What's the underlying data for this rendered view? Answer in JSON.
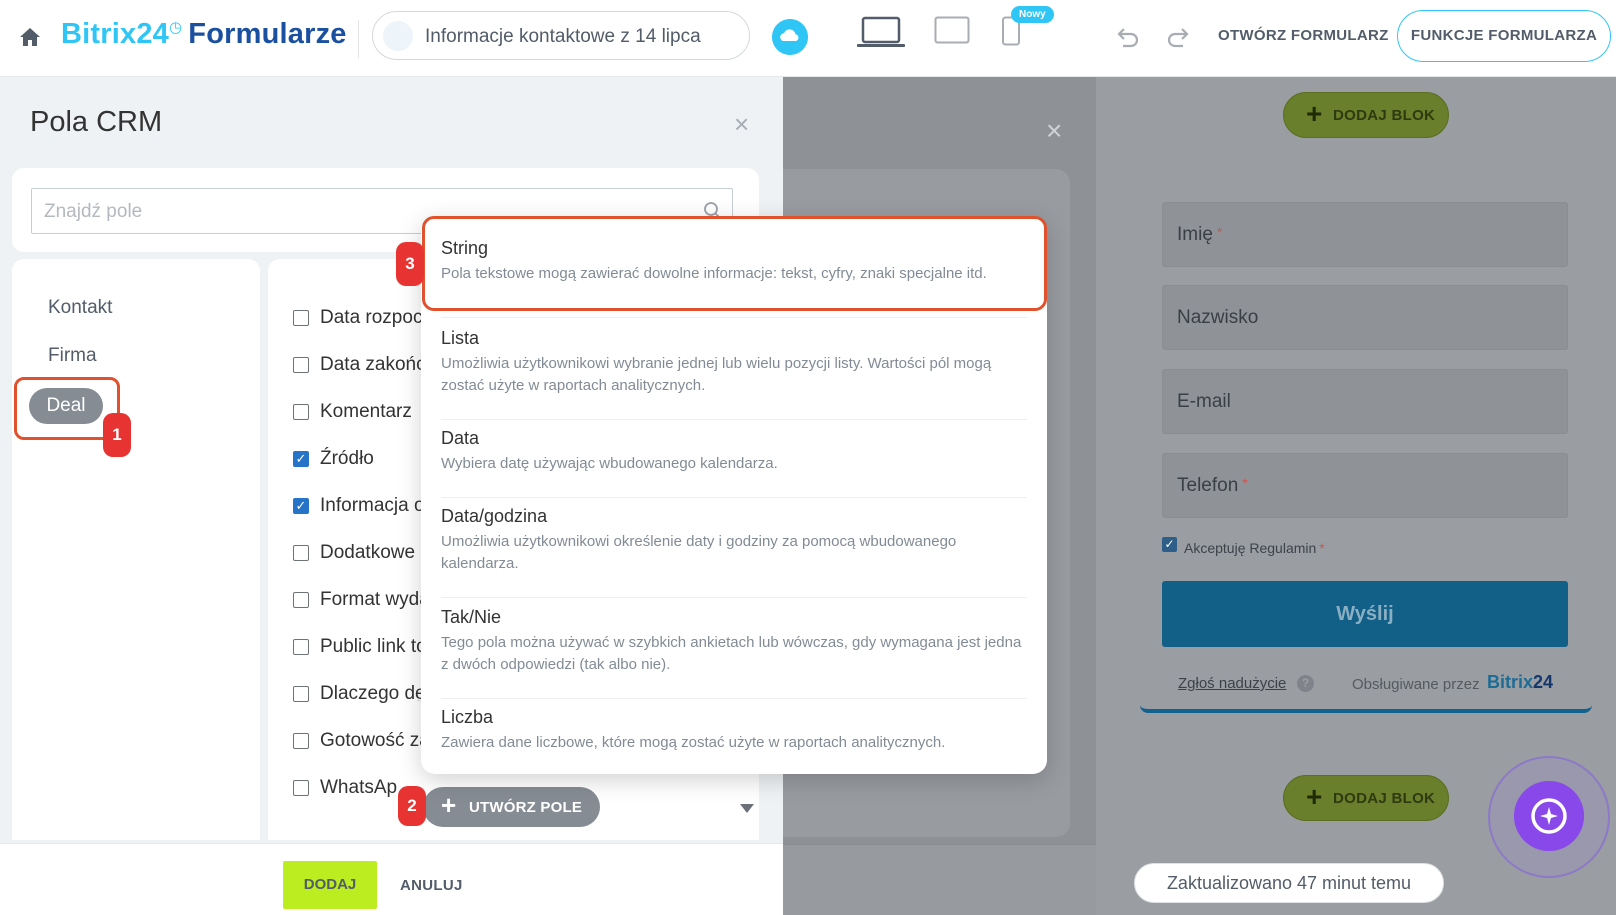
{
  "topbar": {
    "logo_part1": "Bitrix24",
    "logo_clock": "◷",
    "logo_part2": "Formularze",
    "form_title": "Informacje kontaktowe z 14 lipca",
    "new_badge": "Nowy",
    "open_form_label": "OTWÓRZ FORMULARZ",
    "form_functions_label": "FUNKCJE FORMULARZA"
  },
  "panel": {
    "title": "Pola CRM",
    "close_glyph": "×",
    "search_placeholder": "Znajdź pole",
    "categories": [
      "Kontakt",
      "Firma",
      "Deal"
    ],
    "fields": [
      {
        "label": "Data rozpoc",
        "checked": false
      },
      {
        "label": "Data zakońc",
        "checked": false
      },
      {
        "label": "Komentarz",
        "checked": false
      },
      {
        "label": "Źródło",
        "checked": true
      },
      {
        "label": "Informacja o",
        "checked": true
      },
      {
        "label": "Dodatkowe",
        "checked": false
      },
      {
        "label": "Format wyda",
        "checked": false
      },
      {
        "label": "Public link to",
        "checked": false
      },
      {
        "label": "Dlaczego de",
        "checked": false
      },
      {
        "label": "Gotowość za",
        "checked": false
      },
      {
        "label": "WhatsAp",
        "checked": false
      }
    ],
    "create_field_label": "UTWÓRZ POLE",
    "add_button": "DODAJ",
    "cancel_button": "ANULUJ"
  },
  "popup": {
    "items": [
      {
        "title": "String",
        "desc": "Pola tekstowe mogą zawierać dowolne informacje: tekst, cyfry, znaki specjalne itd."
      },
      {
        "title": "Lista",
        "desc": "Umożliwia użytkownikowi wybranie jednej lub wielu pozycji listy. Wartości pól mogą zostać użyte w raportach analitycznych."
      },
      {
        "title": "Data",
        "desc": "Wybiera datę używając wbudowanego kalendarza."
      },
      {
        "title": "Data/godzina",
        "desc": "Umożliwia użytkownikowi określenie daty i godziny za pomocą wbudowanego kalendarza."
      },
      {
        "title": "Tak/Nie",
        "desc": "Tego pola można używać w szybkich ankietach lub wówczas, gdy wymagana jest jedna z dwóch odpowiedzi (tak albo nie)."
      },
      {
        "title": "Liczba",
        "desc": "Zawiera dane liczbowe, które mogą zostać użyte w raportach analitycznych."
      }
    ]
  },
  "steps": [
    "1",
    "2",
    "3"
  ],
  "preview": {
    "add_block_label": "DODAJ BLOK",
    "fields": [
      {
        "label": "Imię",
        "required": true
      },
      {
        "label": "Nazwisko",
        "required": false
      },
      {
        "label": "E-mail",
        "required": false
      },
      {
        "label": "Telefon",
        "required": true
      }
    ],
    "required_mark": "*",
    "terms_label": "Akceptuję Regulamin",
    "submit_label": "Wyślij",
    "report_link": "Zgłoś nadużycie",
    "help_glyph": "?",
    "powered_by": "Obsługiwane przez",
    "powered_logo_1": "Bitrix",
    "powered_logo_2": "24",
    "updated_label": "Zaktualizowano 47 minut temu"
  },
  "icons": {
    "home": "home-icon",
    "cloud": "cloud-icon",
    "laptop": "laptop-icon",
    "tablet": "tablet-icon",
    "phone": "phone-icon",
    "undo": "undo-icon",
    "redo": "redo-icon",
    "search": "search-icon",
    "assistant": "assistant-icon"
  },
  "colors": {
    "accent": "#2fc6f6",
    "highlight": "#e0522d",
    "step_badge": "#e83333",
    "add_button": "#bbed21"
  }
}
